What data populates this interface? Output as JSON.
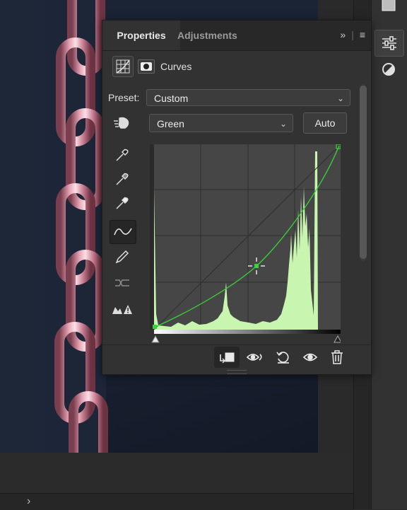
{
  "panel": {
    "tabs": [
      {
        "label": "Properties"
      },
      {
        "label": "Adjustments"
      }
    ],
    "collapse_glyph": "»",
    "menu_glyph": "≡",
    "adjustment_title": "Curves",
    "preset_label": "Preset:",
    "preset_value": "Custom",
    "channel_value": "Green",
    "auto_label": "Auto"
  },
  "icons": {
    "dock": [
      "properties-sliders-icon",
      "adjustments-circle-icon"
    ],
    "tools": [
      "targeted-adjustment-hand-icon",
      "black-point-eyedropper-icon",
      "gray-point-eyedropper-icon",
      "white-point-eyedropper-icon",
      "curve-point-tool-icon",
      "pencil-draw-icon",
      "smooth-curve-icon",
      "clipping-warning-icon"
    ],
    "bottom": [
      "clip-to-layer-icon",
      "view-previous-state-icon",
      "reset-icon",
      "visibility-eye-icon",
      "trash-icon"
    ]
  },
  "colors": {
    "curve": "#39d23a",
    "histogram": "#c8f5b0",
    "panel_bg": "#323232"
  }
}
